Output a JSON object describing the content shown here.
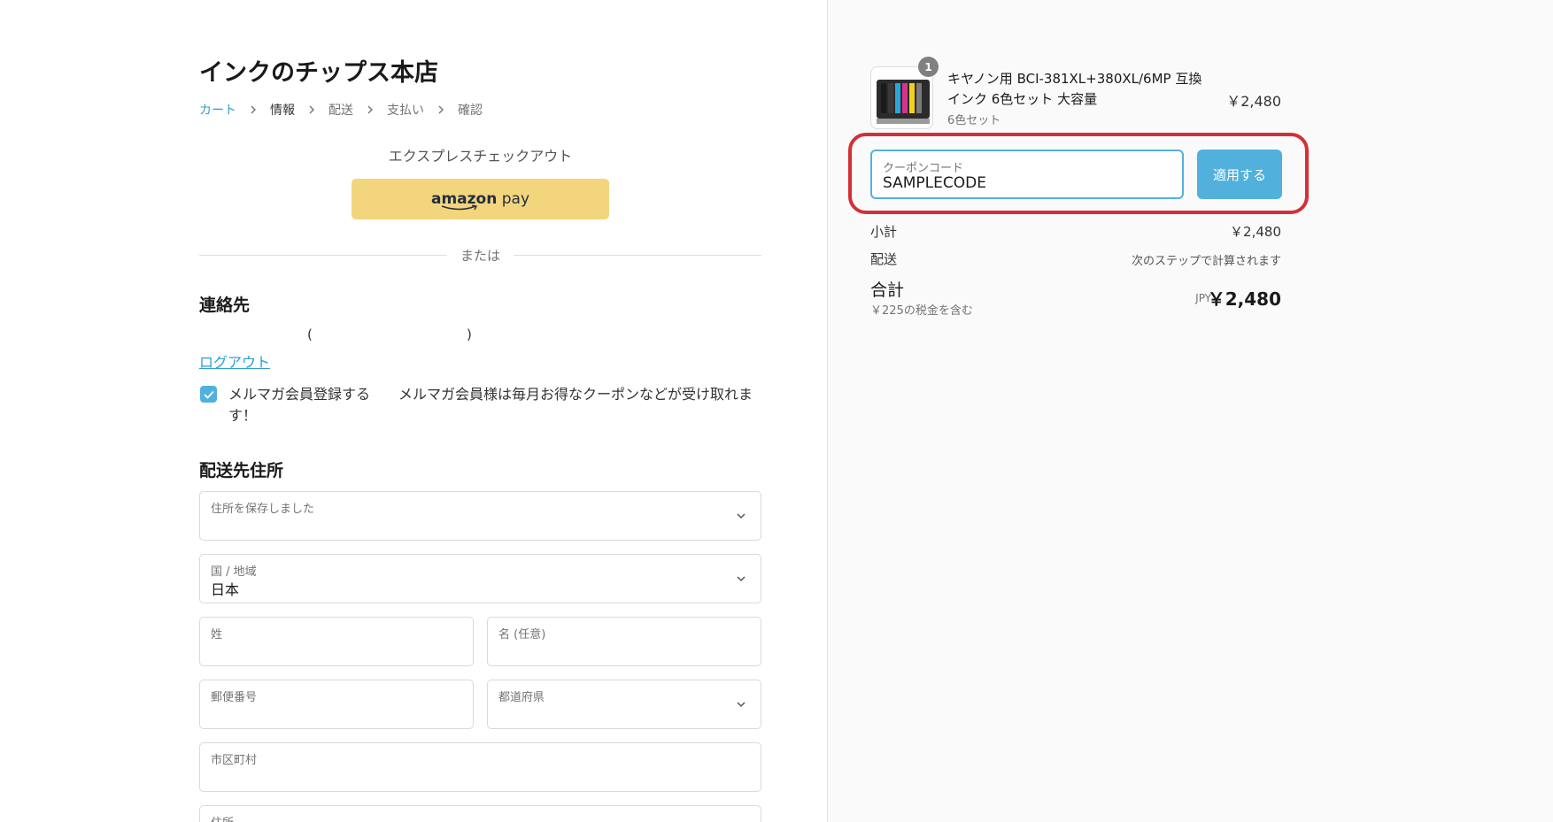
{
  "shop": {
    "title": "インクのチップス本店"
  },
  "breadcrumb": [
    {
      "label": "カート"
    },
    {
      "label": "情報"
    },
    {
      "label": "配送"
    },
    {
      "label": "支払い"
    },
    {
      "label": "確認"
    }
  ],
  "express": {
    "label": "エクスプレスチェックアウト",
    "amazon_brand": "amazon",
    "amazon_pay": "pay",
    "or_label": "または"
  },
  "contact": {
    "title": "連絡先",
    "paren_open": "(",
    "paren_close": ")",
    "logout": "ログアウト",
    "newsletter_checked": true,
    "newsletter_text": "メルマガ会員登録する　　メルマガ会員様は毎月お得なクーポンなどが受け取れます！"
  },
  "shipping_address": {
    "title": "配送先住所",
    "saved_label": "住所を保存しました",
    "country_label": "国 / 地域",
    "country_value": "日本",
    "last_name_label": "姓",
    "first_name_label": "名 (任意)",
    "postal_label": "郵便番号",
    "prefecture_label": "都道府県",
    "city_label": "市区町村",
    "address_label": "住所"
  },
  "order": {
    "quantity": "1",
    "product_name": "キヤノン用 BCI-381XL+380XL/6MP 互換インク 6色セット 大容量",
    "variant": "6色セット",
    "price": "￥2,480",
    "coupon_label": "クーポンコード",
    "coupon_value": "SAMPLECODE",
    "apply_label": "適用する",
    "subtotal_label": "小計",
    "subtotal_value": "￥2,480",
    "shipping_label": "配送",
    "shipping_value": "次のステップで計算されます",
    "total_label": "合計",
    "tax_note": "￥225の税金を含む",
    "currency": "JPY",
    "total_value": "￥2,480"
  },
  "colors": {
    "accent": "#52b1dc",
    "link": "#2c9fd1",
    "amazon": "#f3d57d",
    "highlight": "#d42f36"
  }
}
